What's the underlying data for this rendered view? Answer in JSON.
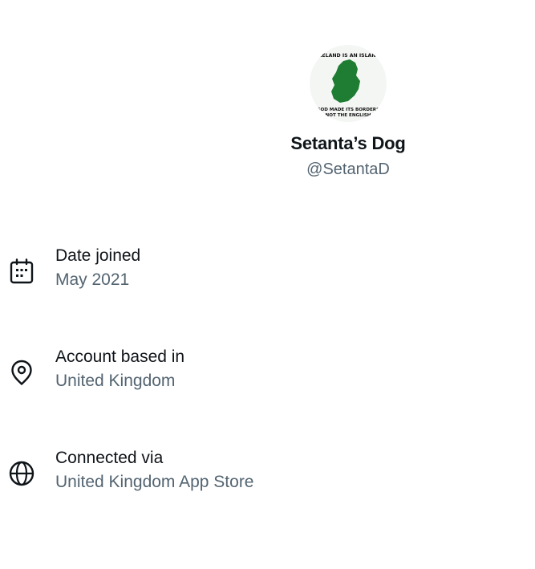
{
  "profile": {
    "display_name": "Setanta’s Dog",
    "handle": "@SetantaD",
    "avatar": {
      "text_top": "IRELAND IS AN ISLAND",
      "text_bottom_1": "GOD MADE ITS BORDERS",
      "text_bottom_2": "NOT THE ENGLISH",
      "map_color": "#1e7d32"
    }
  },
  "about": {
    "rows": [
      {
        "icon": "calendar-icon",
        "label": "Date joined",
        "value": "May 2021"
      },
      {
        "icon": "location-pin-icon",
        "label": "Account based in",
        "value": "United Kingdom"
      },
      {
        "icon": "globe-icon",
        "label": "Connected via",
        "value": "United Kingdom App Store"
      }
    ]
  },
  "colors": {
    "primary_text": "#0f1419",
    "secondary_text": "#536471",
    "background": "#ffffff"
  }
}
